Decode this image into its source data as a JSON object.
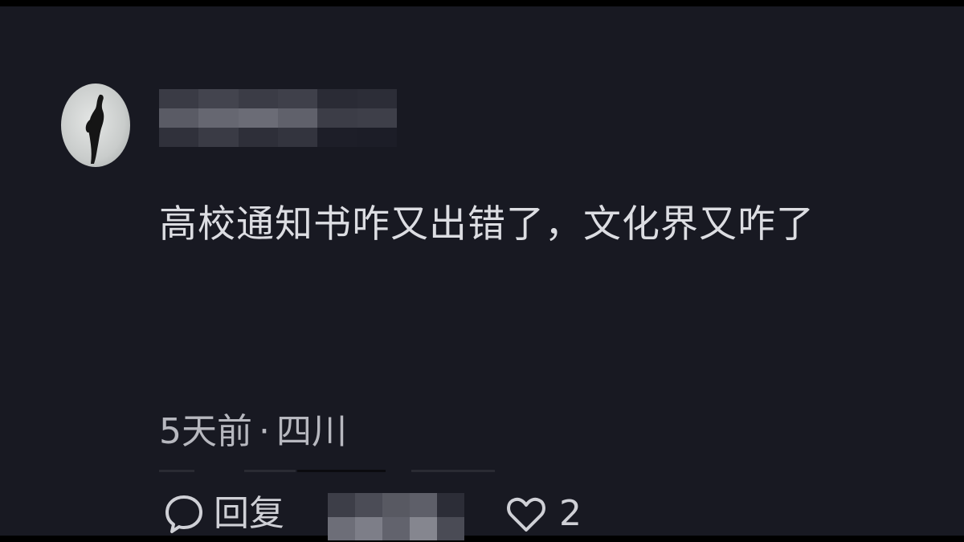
{
  "comment": {
    "username": "",
    "text": "高校通知书咋又出错了，文化界又咋了",
    "time": "5天前",
    "separator": "·",
    "location": "四川"
  },
  "actions": {
    "reply_label": "回复",
    "like_count": "2"
  },
  "icons": {
    "reply": "speech-bubble-icon",
    "like": "heart-outline-icon"
  },
  "colors": {
    "background": "#181922",
    "primary_text": "#dcdde2",
    "secondary_text": "#b7b8bf"
  }
}
